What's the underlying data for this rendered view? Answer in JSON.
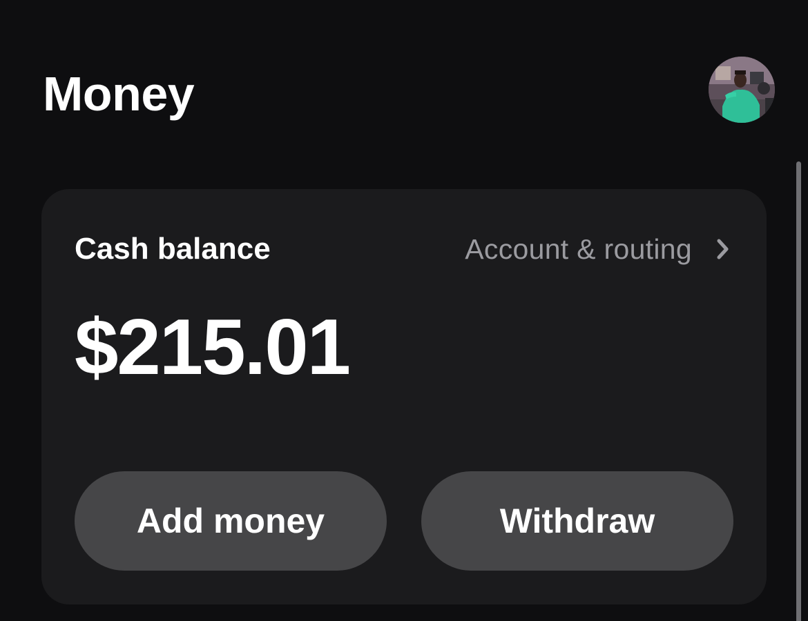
{
  "header": {
    "title": "Money",
    "avatar_icon": "user-avatar-photo"
  },
  "balance_card": {
    "label": "Cash balance",
    "account_link_label": "Account & routing",
    "account_link_icon": "chevron-right-icon",
    "amount": "$215.01",
    "add_money_label": "Add money",
    "withdraw_label": "Withdraw"
  },
  "colors": {
    "background": "#0e0e10",
    "card": "#1b1b1d",
    "button": "#464648",
    "muted_text": "#9b9ba0",
    "text": "#ffffff"
  }
}
